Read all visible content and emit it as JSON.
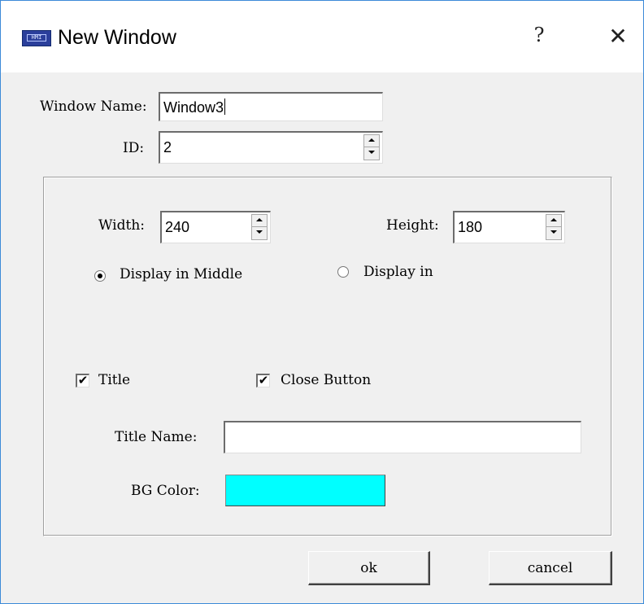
{
  "window": {
    "title": "New Window",
    "help_label": "?",
    "close_label": "✕",
    "icon_label": "HMI"
  },
  "form": {
    "window_name_label": "Window Name:",
    "window_name_value": "Window3",
    "id_label": "ID:",
    "id_value": "2"
  },
  "size": {
    "width_label": "Width:",
    "width_value": "240",
    "height_label": "Height:",
    "height_value": "180"
  },
  "position": {
    "display_middle_label": "Display in Middle",
    "display_middle_selected": true,
    "display_in_label": "Display in",
    "display_in_selected": false
  },
  "options": {
    "title_label": "Title",
    "title_checked": true,
    "close_button_label": "Close Button",
    "close_button_checked": true,
    "check_mark": "✔"
  },
  "appearance": {
    "title_name_label": "Title Name:",
    "title_name_value": "",
    "bg_color_label": "BG Color:",
    "bg_color": "#00ffff"
  },
  "buttons": {
    "ok_label": "ok",
    "cancel_label": "cancel"
  },
  "colors": {
    "dialog_bg": "#f0f0f0",
    "border_accent": "#3c8ad8"
  }
}
